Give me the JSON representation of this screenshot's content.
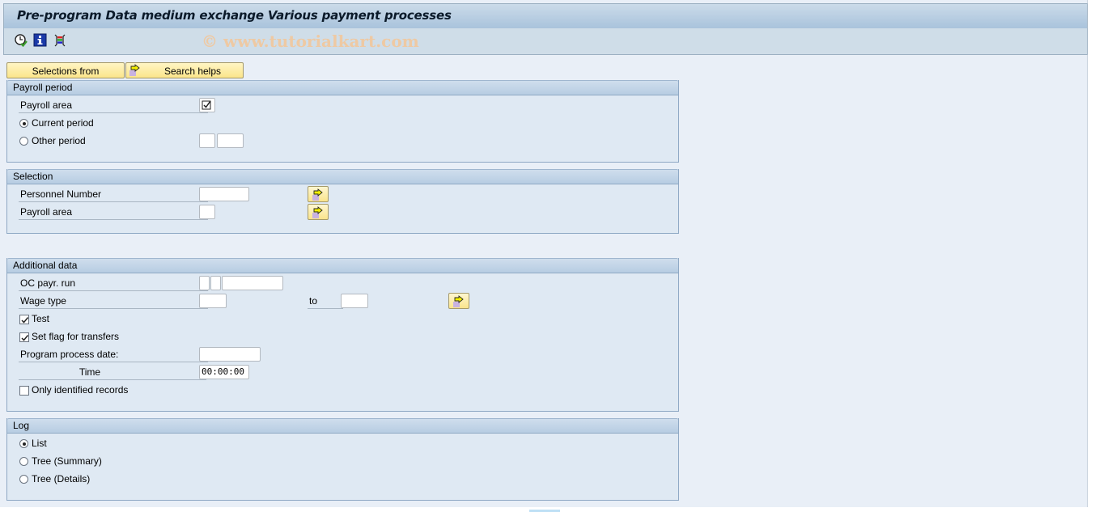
{
  "window": {
    "title": "Pre-program Data medium exchange Various payment processes",
    "watermark": "© www.tutorialkart.com"
  },
  "toolbar": {
    "icons": [
      "execute-icon",
      "info-icon",
      "variant-icon"
    ]
  },
  "buttons": {
    "selections_from": "Selections from",
    "search_helps": "Search helps"
  },
  "payroll_period": {
    "header": "Payroll period",
    "payroll_area_label": "Payroll area",
    "payroll_area_checked": true,
    "current_period_label": "Current period",
    "other_period_label": "Other period",
    "selected": "current_period",
    "other_period_value_1": "",
    "other_period_value_2": ""
  },
  "selection": {
    "header": "Selection",
    "personnel_number_label": "Personnel Number",
    "personnel_number_value": "",
    "payroll_area_label": "Payroll area",
    "payroll_area_value": ""
  },
  "additional_data": {
    "header": "Additional data",
    "oc_payr_run_label": "OC payr. run",
    "wage_type_label": "Wage type",
    "wage_type_from": "",
    "to_label": "to",
    "wage_type_to": "",
    "test_label": "Test",
    "test_checked": true,
    "set_flag_label": "Set flag for transfers",
    "set_flag_checked": true,
    "program_process_date_label": "Program process date:",
    "program_process_date_value": "",
    "time_label": "Time",
    "time_value": "00:00:00",
    "only_identified_label": "Only identified records",
    "only_identified_checked": false
  },
  "log": {
    "header": "Log",
    "options": [
      "List",
      "Tree (Summary)",
      "Tree (Details)"
    ],
    "selected": "List"
  }
}
